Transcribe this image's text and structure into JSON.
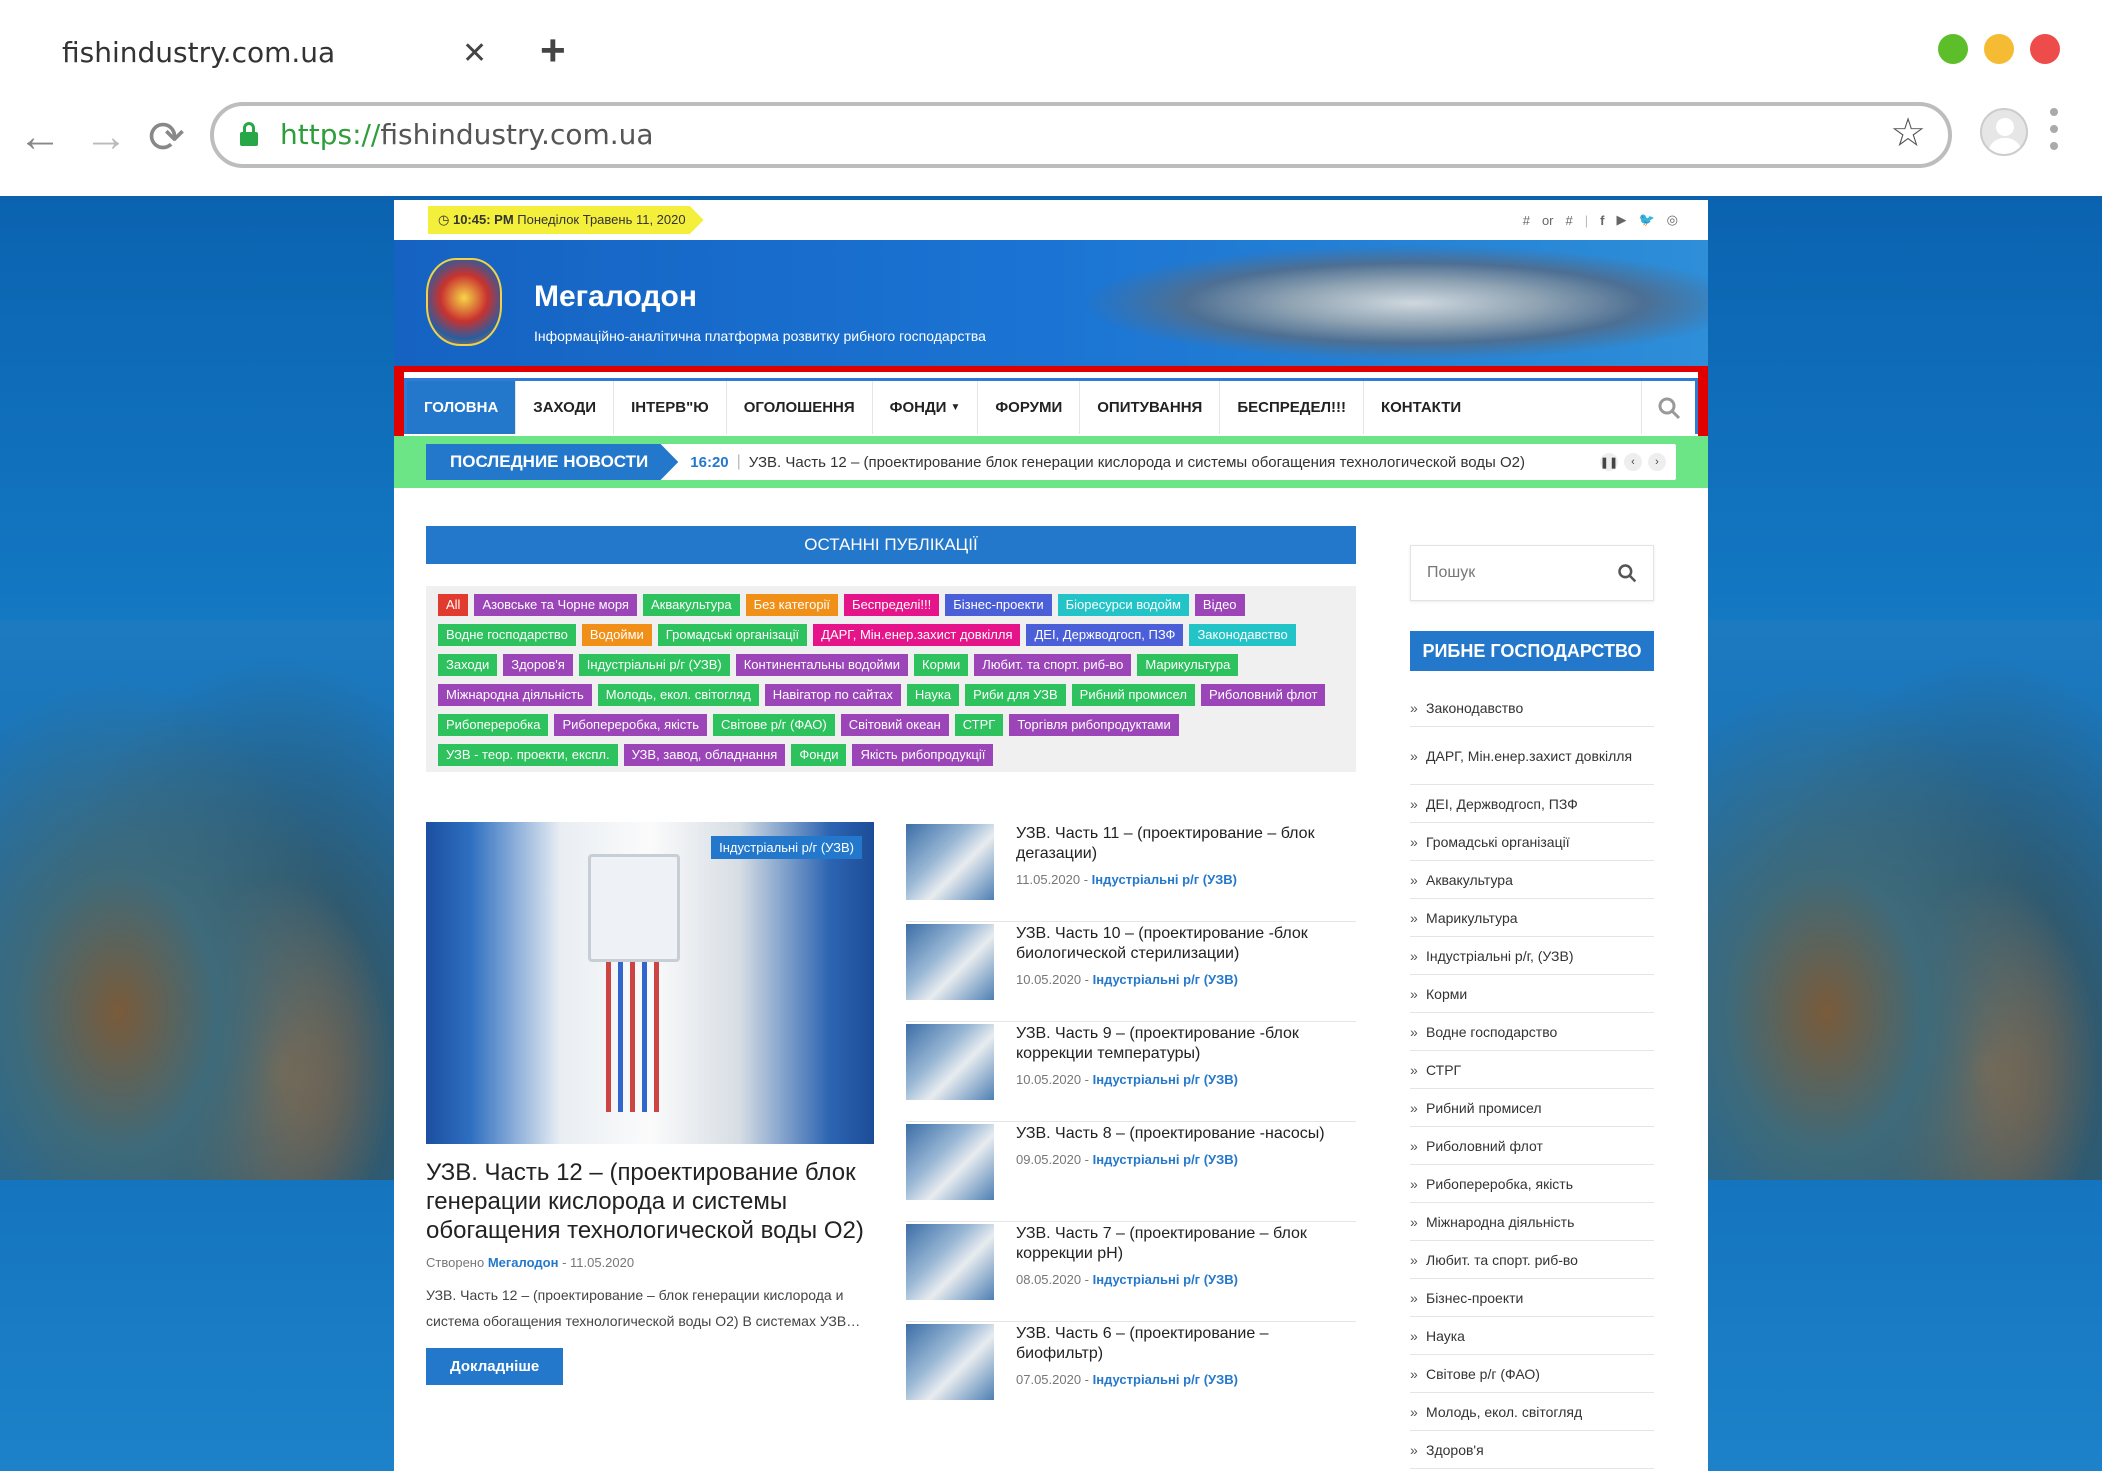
{
  "browser": {
    "tab_title": "fishindustry.com.ua",
    "url_proto": "https://",
    "url_host": "fishindustry.com.ua",
    "dots": [
      "#5cbf2a",
      "#f4bb33",
      "#ee4b4b"
    ]
  },
  "topbar": {
    "time": "10:45: PM",
    "date": "Понеділок Травень 11, 2020",
    "links_left": "#",
    "links_or": "or",
    "links_right": "#",
    "social_icons": [
      "facebook-icon",
      "youtube-icon",
      "twitter-icon",
      "instagram-icon"
    ]
  },
  "header": {
    "title": "Мегалодон",
    "subtitle": "Інформаційно-аналітична платформа розвитку рибного господарства"
  },
  "nav": {
    "items": [
      "ГОЛОВНА",
      "ЗАХОДИ",
      "ІНТЕРВ\"Ю",
      "ОГОЛОШЕННЯ",
      "ФОНДИ",
      "ФОРУМИ",
      "ОПИТУВАННЯ",
      "БЕСПРЕДЕЛ!!!",
      "КОНТАКТИ"
    ],
    "active_index": 0
  },
  "ticker": {
    "label": "ПОСЛЕДНИЕ НОВОСТИ",
    "time": "16:20",
    "text": "УЗВ. Часть 12 – (проектирование блок генерации кислорода и системы обогащения технологической воды О2)"
  },
  "main": {
    "section_title": "ОСТАННІ ПУБЛІКАЦІЇ",
    "tags": [
      {
        "label": "All",
        "color": "#e03b2e"
      },
      {
        "label": "Азовське та Чорне моря",
        "color": "#9b45b8"
      },
      {
        "label": "Аквакультура",
        "color": "#2ec25e"
      },
      {
        "label": "Без категорії",
        "color": "#f09018"
      },
      {
        "label": "Беспределі!!!",
        "color": "#e6148a"
      },
      {
        "label": "Бізнес-проекти",
        "color": "#4b5fd9"
      },
      {
        "label": "Біоресурси водойм",
        "color": "#22c4c8"
      },
      {
        "label": "Відео",
        "color": "#9b45b8"
      },
      {
        "label": "Водне господарство",
        "color": "#2ec25e"
      },
      {
        "label": "Водойми",
        "color": "#f09018"
      },
      {
        "label": "Громадські організації",
        "color": "#2ec25e"
      },
      {
        "label": "ДАРГ, Мін.енер.захист довкілля",
        "color": "#e6148a"
      },
      {
        "label": "ДЕІ, Держводгосп, ПЗФ",
        "color": "#4b5fd9"
      },
      {
        "label": "Законодавство",
        "color": "#22c4c8"
      },
      {
        "label": "Заходи",
        "color": "#2ec25e"
      },
      {
        "label": "Здоров'я",
        "color": "#9b45b8"
      },
      {
        "label": "Індустріальні р/г (УЗВ)",
        "color": "#2ec25e"
      },
      {
        "label": "Континентальны водойми",
        "color": "#9b45b8"
      },
      {
        "label": "Корми",
        "color": "#2ec25e"
      },
      {
        "label": "Любит. та спорт. риб-во",
        "color": "#9b45b8"
      },
      {
        "label": "Марикультура",
        "color": "#2ec25e"
      },
      {
        "label": "Міжнародна діяльність",
        "color": "#9b45b8"
      },
      {
        "label": "Молодь, екол. світогляд",
        "color": "#2ec25e"
      },
      {
        "label": "Навігатор по сайтах",
        "color": "#9b45b8"
      },
      {
        "label": "Наука",
        "color": "#2ec25e"
      },
      {
        "label": "Риби для УЗВ",
        "color": "#2ec25e"
      },
      {
        "label": "Рибний промисел",
        "color": "#2ec25e"
      },
      {
        "label": "Риболовний флот",
        "color": "#9b45b8"
      },
      {
        "label": "Рибопереробка",
        "color": "#2ec25e"
      },
      {
        "label": "Рибопереробка, якість",
        "color": "#9b45b8"
      },
      {
        "label": "Світове р/г (ФАО)",
        "color": "#2ec25e"
      },
      {
        "label": "Світовий океан",
        "color": "#9b45b8"
      },
      {
        "label": "СТРГ",
        "color": "#2ec25e"
      },
      {
        "label": "Торгівля рибопродуктами",
        "color": "#9b45b8"
      },
      {
        "label": "УЗВ - теор. проекти, експл.",
        "color": "#2ec25e"
      },
      {
        "label": "УЗВ, завод, обладнання",
        "color": "#9b45b8"
      },
      {
        "label": "Фонди",
        "color": "#2ec25e"
      },
      {
        "label": "Якість рибопродукції",
        "color": "#9b45b8"
      }
    ],
    "featured": {
      "category": "Індустріальні р/г (УЗВ)",
      "title": "УЗВ. Часть 12 – (проектирование блок генерации кислорода и системы обогащения технологической воды О2)",
      "meta_prefix": "Створено",
      "author": "Мегалодон",
      "date": "- 11.05.2020",
      "excerpt": "УЗВ. Часть 12 – (проектирование – блок генерации кислорода и система обогащения технологической воды О2) В системах УЗВ…",
      "more_label": "Докладніше"
    },
    "posts": [
      {
        "title": "УЗВ. Часть 11 – (проектирование – блок дегазации)",
        "date": "11.05.2020 -",
        "cat": "Індустріальні р/г (УЗВ)"
      },
      {
        "title": "УЗВ. Часть 10 – (проектирование -блок биологической стерилизации)",
        "date": "10.05.2020 -",
        "cat": "Індустріальні р/г (УЗВ)"
      },
      {
        "title": "УЗВ. Часть 9 – (проектирование -блок коррекции температуры)",
        "date": "10.05.2020 -",
        "cat": "Індустріальні р/г (УЗВ)"
      },
      {
        "title": "УЗВ. Часть 8 – (проектирование -насосы)",
        "date": "09.05.2020 -",
        "cat": "Індустріальні р/г (УЗВ)"
      },
      {
        "title": "УЗВ. Часть 7 – (проектирование – блок коррекции pH)",
        "date": "08.05.2020 -",
        "cat": "Індустріальні р/г (УЗВ)"
      },
      {
        "title": "УЗВ. Часть 6 – (проектирование – биофильтр)",
        "date": "07.05.2020 -",
        "cat": "Індустріальні р/г (УЗВ)"
      }
    ]
  },
  "sidebar": {
    "search_placeholder": "Пошук",
    "heading": "РИБНЕ ГОСПОДАРСТВО",
    "items": [
      "Законодавство",
      "ДАРГ, Мін.енер.захист довкілля",
      "ДЕІ, Держводгосп, ПЗФ",
      "Громадські організації",
      "Аквакультура",
      "Марикультура",
      "Індустріальні р/г, (УЗВ)",
      "Корми",
      "Водне господарство",
      "СТРГ",
      "Рибний промисел",
      "Риболовний флот",
      "Рибопереробка, якість",
      "Міжнародна діяльність",
      "Любит. та спорт. риб-во",
      "Бізнес-проекти",
      "Наука",
      "Світове р/г (ФАО)",
      "Молодь, екол. світогляд",
      "Здоров'я"
    ]
  }
}
